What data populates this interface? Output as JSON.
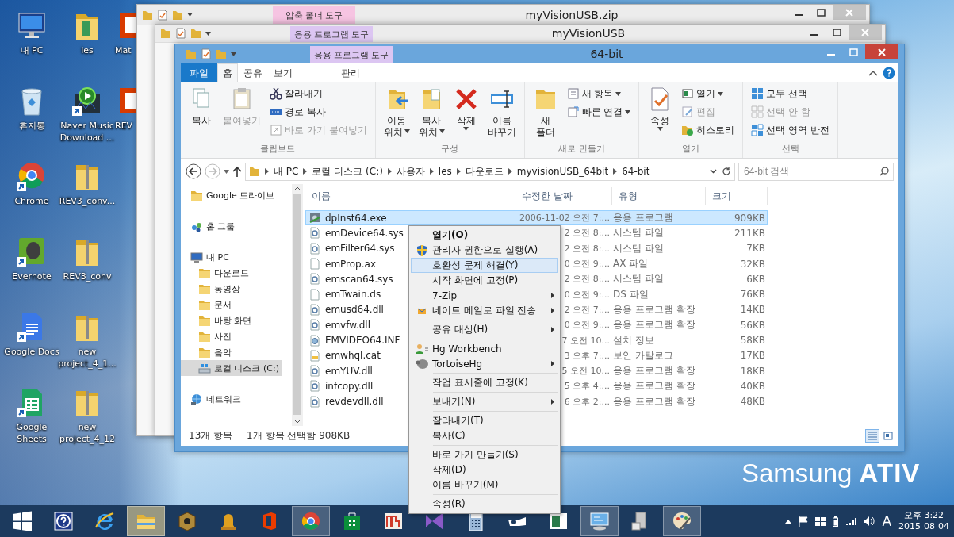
{
  "desktop": {
    "icons": [
      {
        "label": "내 PC",
        "kind": "pc",
        "shortcut": false
      },
      {
        "label": "휴지통",
        "kind": "trash",
        "shortcut": false
      },
      {
        "label": "Chrome",
        "kind": "chrome",
        "shortcut": true
      },
      {
        "label": "Evernote",
        "kind": "evernote",
        "shortcut": true
      },
      {
        "label": "Google Docs",
        "kind": "docs",
        "shortcut": true
      },
      {
        "label": "Google Sheets",
        "kind": "sheets",
        "shortcut": true
      },
      {
        "label": "les",
        "kind": "folder",
        "shortcut": false
      },
      {
        "label": "Naver Music Download ...",
        "kind": "player",
        "shortcut": true
      },
      {
        "label": "REV3_conv...",
        "kind": "zip",
        "shortcut": false
      },
      {
        "label": "REV3_conv",
        "kind": "zip",
        "shortcut": false
      },
      {
        "label": "new project_4_1...",
        "kind": "zip",
        "shortcut": false
      },
      {
        "label": "new project_4_12",
        "kind": "zip",
        "shortcut": false
      },
      {
        "label": "Mat",
        "kind": "office",
        "shortcut": false
      },
      {
        "label": "REV",
        "kind": "office",
        "shortcut": false
      }
    ],
    "wallpaper_text": "Samsung **ATIV**"
  },
  "back_windows": [
    {
      "title": "myVisionUSB.zip",
      "context_tab": {
        "label": "압축 폴더 도구",
        "color": "#f6c4e2"
      }
    },
    {
      "title": "myVisionUSB",
      "context_tab": {
        "label": "응용 프로그램 도구",
        "color": "#dcc6f2"
      }
    }
  ],
  "window": {
    "title": "64-bit",
    "context_tab": {
      "label": "응용 프로그램 도구",
      "color": "#dcc6f2"
    },
    "tabs": [
      {
        "label": "파일",
        "kind": "file",
        "selected": false
      },
      {
        "label": "홈",
        "kind": "normal",
        "selected": true
      },
      {
        "label": "공유",
        "kind": "normal",
        "selected": false
      },
      {
        "label": "보기",
        "kind": "normal",
        "selected": false
      },
      {
        "label": "관리",
        "kind": "context",
        "selected": false
      }
    ],
    "ribbon": [
      {
        "title": "클립보드",
        "buttons": [
          {
            "kind": "large",
            "lines": [
              "복사"
            ],
            "dropdown": false,
            "disabled": false
          },
          {
            "kind": "large",
            "lines": [
              "붙여넣기"
            ],
            "dropdown": false,
            "disabled": true
          },
          {
            "kind": "small",
            "lines": [
              "잘라내기"
            ],
            "dropdown": false,
            "disabled": false
          },
          {
            "kind": "small",
            "lines": [
              "경로 복사"
            ],
            "dropdown": false,
            "disabled": false
          },
          {
            "kind": "small",
            "lines": [
              "바로 가기 붙여넣기"
            ],
            "dropdown": false,
            "disabled": true
          }
        ]
      },
      {
        "title": "구성",
        "buttons": [
          {
            "kind": "large",
            "lines": [
              "이동",
              "위치"
            ],
            "dropdown": true,
            "disabled": false
          },
          {
            "kind": "large",
            "lines": [
              "복사",
              "위치"
            ],
            "dropdown": true,
            "disabled": false
          },
          {
            "kind": "large",
            "lines": [
              "삭제"
            ],
            "dropdown": true,
            "disabled": false
          },
          {
            "kind": "large",
            "lines": [
              "이름",
              "바꾸기"
            ],
            "dropdown": false,
            "disabled": false
          }
        ]
      },
      {
        "title": "새로 만들기",
        "buttons": [
          {
            "kind": "large",
            "lines": [
              "새",
              "폴더"
            ],
            "dropdown": false,
            "disabled": false
          },
          {
            "kind": "small",
            "lines": [
              "새 항목"
            ],
            "dropdown": true,
            "disabled": false
          },
          {
            "kind": "small",
            "lines": [
              "빠른 연결"
            ],
            "dropdown": true,
            "disabled": false
          }
        ]
      },
      {
        "title": "열기",
        "buttons": [
          {
            "kind": "large",
            "lines": [
              "속성"
            ],
            "dropdown": true,
            "disabled": false
          },
          {
            "kind": "small",
            "lines": [
              "열기"
            ],
            "dropdown": true,
            "disabled": false
          },
          {
            "kind": "small",
            "lines": [
              "편집"
            ],
            "dropdown": false,
            "disabled": true
          },
          {
            "kind": "small",
            "lines": [
              "히스토리"
            ],
            "dropdown": false,
            "disabled": false
          }
        ]
      },
      {
        "title": "선택",
        "buttons": [
          {
            "kind": "small",
            "lines": [
              "모두 선택"
            ],
            "dropdown": false,
            "disabled": false
          },
          {
            "kind": "small",
            "lines": [
              "선택 안 함"
            ],
            "dropdown": false,
            "disabled": true
          },
          {
            "kind": "small",
            "lines": [
              "선택 영역 반전"
            ],
            "dropdown": false,
            "disabled": false
          }
        ]
      }
    ],
    "breadcrumbs": [
      "내 PC",
      "로컬 디스크 (C:)",
      "사용자",
      "les",
      "다운로드",
      "myvisionUSB_64bit",
      "64-bit"
    ],
    "search": {
      "placeholder": "64-bit 검색"
    },
    "nav": [
      {
        "label": "Google 드라이브",
        "kind": "folder",
        "selected": false
      },
      {
        "label": "홈 그룹",
        "kind": "homegroup",
        "selected": false
      },
      {
        "label": "내 PC",
        "kind": "pc",
        "selected": false,
        "children": [
          {
            "label": "다운로드",
            "kind": "folder",
            "selected": false
          },
          {
            "label": "동영상",
            "kind": "folder",
            "selected": false
          },
          {
            "label": "문서",
            "kind": "folder",
            "selected": false
          },
          {
            "label": "바탕 화면",
            "kind": "folder",
            "selected": false
          },
          {
            "label": "사진",
            "kind": "folder",
            "selected": false
          },
          {
            "label": "음악",
            "kind": "folder",
            "selected": false
          },
          {
            "label": "로컬 디스크 (C:)",
            "kind": "disk",
            "selected": true
          }
        ]
      },
      {
        "label": "네트워크",
        "kind": "network",
        "selected": false
      }
    ],
    "columns": [
      "이름",
      "수정한 날짜",
      "유형",
      "크기"
    ],
    "files": [
      {
        "name": "dpInst64.exe",
        "date": "2006-11-02 오전 7:...",
        "type": "응용 프로그램",
        "size": "909KB",
        "kind": "app",
        "selected": true
      },
      {
        "name": "emDevice64.sys",
        "date": "2 오전 8:...",
        "type": "시스템 파일",
        "size": "211KB",
        "kind": "system",
        "selected": false
      },
      {
        "name": "emFilter64.sys",
        "date": "2 오전 8:...",
        "type": "시스템 파일",
        "size": "7KB",
        "kind": "system",
        "selected": false
      },
      {
        "name": "emProp.ax",
        "date": "0 오전 9:...",
        "type": "AX 파일",
        "size": "32KB",
        "kind": "blank",
        "selected": false
      },
      {
        "name": "emscan64.sys",
        "date": "2 오전 8:...",
        "type": "시스템 파일",
        "size": "6KB",
        "kind": "system",
        "selected": false
      },
      {
        "name": "emTwain.ds",
        "date": "0 오전 9:...",
        "type": "DS 파일",
        "size": "76KB",
        "kind": "blank",
        "selected": false
      },
      {
        "name": "emusd64.dll",
        "date": "2 오전 7:...",
        "type": "응용 프로그램 확장",
        "size": "14KB",
        "kind": "system",
        "selected": false
      },
      {
        "name": "emvfw.dll",
        "date": "0 오전 9:...",
        "type": "응용 프로그램 확장",
        "size": "56KB",
        "kind": "system",
        "selected": false
      },
      {
        "name": "EMVIDEO64.INF",
        "date": "7 오전 10...",
        "type": "설치 정보",
        "size": "58KB",
        "kind": "setup",
        "selected": false
      },
      {
        "name": "emwhql.cat",
        "date": "3 오후 7:...",
        "type": "보안 카탈로그",
        "size": "17KB",
        "kind": "catalog",
        "selected": false
      },
      {
        "name": "emYUV.dll",
        "date": "5 오전 10...",
        "type": "응용 프로그램 확장",
        "size": "18KB",
        "kind": "system",
        "selected": false
      },
      {
        "name": "infcopy.dll",
        "date": "5 오후 4:...",
        "type": "응용 프로그램 확장",
        "size": "40KB",
        "kind": "system",
        "selected": false
      },
      {
        "name": "revdevdll.dll",
        "date": "6 오후 2:...",
        "type": "응용 프로그램 확장",
        "size": "48KB",
        "kind": "system",
        "selected": false
      }
    ],
    "status": {
      "count": "13개 항목",
      "selection": "1개 항목 선택함 908KB",
      "views": [
        {
          "kind": "details",
          "selected": true
        },
        {
          "kind": "icons",
          "selected": false
        }
      ]
    }
  },
  "context_menu": [
    [
      {
        "label": "열기(O)",
        "kind": "plain",
        "default": true,
        "selected": false,
        "submenu": false
      },
      {
        "label": "관리자 권한으로 실행(A)",
        "kind": "admin",
        "default": false,
        "selected": false,
        "submenu": false
      },
      {
        "label": "호환성 문제 해결(Y)",
        "kind": "plain",
        "default": false,
        "selected": true,
        "submenu": false
      },
      {
        "label": "시작 화면에 고정(P)",
        "kind": "plain",
        "default": false,
        "selected": false,
        "submenu": false
      },
      {
        "label": "7-Zip",
        "kind": "plain",
        "default": false,
        "selected": false,
        "submenu": true
      },
      {
        "label": "네이트 메일로 파일 전송",
        "kind": "mail",
        "default": false,
        "selected": false,
        "submenu": true
      }
    ],
    [
      {
        "label": "공유 대상(H)",
        "kind": "plain",
        "default": false,
        "selected": false,
        "submenu": true
      }
    ],
    [
      {
        "label": "Hg Workbench",
        "kind": "workbench",
        "default": false,
        "selected": false,
        "submenu": false
      },
      {
        "label": "TortoiseHg",
        "kind": "tortoise",
        "default": false,
        "selected": false,
        "submenu": true
      }
    ],
    [
      {
        "label": "작업 표시줄에 고정(K)",
        "kind": "plain",
        "default": false,
        "selected": false,
        "submenu": false
      }
    ],
    [
      {
        "label": "보내기(N)",
        "kind": "plain",
        "default": false,
        "selected": false,
        "submenu": true
      }
    ],
    [
      {
        "label": "잘라내기(T)",
        "kind": "plain",
        "default": false,
        "selected": false,
        "submenu": false
      },
      {
        "label": "복사(C)",
        "kind": "plain",
        "default": false,
        "selected": false,
        "submenu": false
      }
    ],
    [
      {
        "label": "바로 가기 만들기(S)",
        "kind": "plain",
        "default": false,
        "selected": false,
        "submenu": false
      },
      {
        "label": "삭제(D)",
        "kind": "plain",
        "default": false,
        "selected": false,
        "submenu": false
      },
      {
        "label": "이름 바꾸기(M)",
        "kind": "plain",
        "default": false,
        "selected": false,
        "submenu": false
      }
    ],
    [
      {
        "label": "속성(R)",
        "kind": "plain",
        "default": false,
        "selected": false,
        "submenu": false
      }
    ]
  ],
  "taskbar": {
    "items": [
      {
        "kind": "start",
        "selected": false,
        "open": false
      },
      {
        "kind": "help",
        "selected": false,
        "open": false
      },
      {
        "kind": "browser",
        "selected": false,
        "open": false
      },
      {
        "kind": "explorer",
        "selected": true,
        "open": true
      },
      {
        "kind": "box",
        "selected": false,
        "open": false
      },
      {
        "kind": "bell",
        "selected": false,
        "open": false
      },
      {
        "kind": "office",
        "selected": false,
        "open": false
      },
      {
        "kind": "chrome",
        "selected": false,
        "open": true
      },
      {
        "kind": "store",
        "selected": false,
        "open": false
      },
      {
        "kind": "chart",
        "selected": false,
        "open": false
      },
      {
        "kind": "vs",
        "selected": false,
        "open": false
      },
      {
        "kind": "calculator",
        "selected": false,
        "open": false
      },
      {
        "kind": "hand",
        "selected": false,
        "open": false
      },
      {
        "kind": "panel",
        "selected": false,
        "open": false
      },
      {
        "kind": "remote",
        "selected": false,
        "open": true
      },
      {
        "kind": "tools",
        "selected": false,
        "open": false
      },
      {
        "kind": "paint",
        "selected": false,
        "open": true
      }
    ],
    "ime": "A",
    "time": "오후 3:22",
    "date": "2015-08-04"
  }
}
